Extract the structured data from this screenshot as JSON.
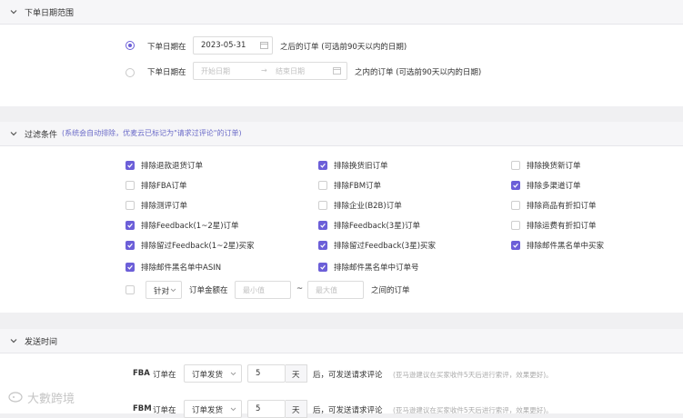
{
  "colors": {
    "accent": "#6c5fd8",
    "hint": "#6b6bc8"
  },
  "date_section": {
    "title": "下单日期范围",
    "option1": {
      "prefix": "下单日期在",
      "date_value": "2023-05-31",
      "suffix": "之后的订单 (可选前90天以内的日期)",
      "selected": true
    },
    "option2": {
      "prefix": "下单日期在",
      "start_placeholder": "开始日期",
      "arrow": "→",
      "end_placeholder": "结束日期",
      "suffix": "之内的订单 (可选前90天以内的日期)",
      "selected": false
    }
  },
  "filter_section": {
    "title": "过滤条件",
    "hint": "(系统会自动排除，优麦云已标记为\"请求过评论\"的订单)",
    "checkboxes": [
      {
        "label": "排除退款退货订单",
        "checked": true
      },
      {
        "label": "排除换货旧订单",
        "checked": true
      },
      {
        "label": "排除换货新订单",
        "checked": false
      },
      {
        "label": "排除FBA订单",
        "checked": false
      },
      {
        "label": "排除FBM订单",
        "checked": false
      },
      {
        "label": "排除多渠道订单",
        "checked": true
      },
      {
        "label": "排除测评订单",
        "checked": false
      },
      {
        "label": "排除企业(B2B)订单",
        "checked": false
      },
      {
        "label": "排除商品有折扣订单",
        "checked": false
      },
      {
        "label": "排除Feedback(1~2星)订单",
        "checked": true
      },
      {
        "label": "排除Feedback(3星)订单",
        "checked": true
      },
      {
        "label": "排除运费有折扣订单",
        "checked": false
      },
      {
        "label": "排除留过Feedback(1~2星)买家",
        "checked": true
      },
      {
        "label": "排除留过Feedback(3星)买家",
        "checked": true
      },
      {
        "label": "排除邮件黑名单中买家",
        "checked": true
      },
      {
        "label": "排除邮件黑名单中ASIN",
        "checked": true
      },
      {
        "label": "排除邮件黑名单中订单号",
        "checked": true
      }
    ],
    "amount_row": {
      "checked": false,
      "select_value": "针对",
      "label": "订单金额在",
      "min_placeholder": "最小值",
      "tilde": "~",
      "max_placeholder": "最大值",
      "suffix": "之间的订单"
    }
  },
  "send_section": {
    "title": "发送时间",
    "rows": [
      {
        "channel": "FBA",
        "label": "订单在",
        "select_value": "订单发货",
        "days": "5",
        "unit": "天",
        "suffix": "后，可发送请求评论",
        "note": "(亚马逊建议在买家收件5天后进行索评，效果更好)。"
      },
      {
        "channel": "FBM",
        "label": "订单在",
        "select_value": "订单发货",
        "days": "5",
        "unit": "天",
        "suffix": "后，可发送请求评论",
        "note": "(亚马逊建议在买家收件5天后进行索评，效果更好)。"
      }
    ]
  },
  "watermark": "大數跨境"
}
